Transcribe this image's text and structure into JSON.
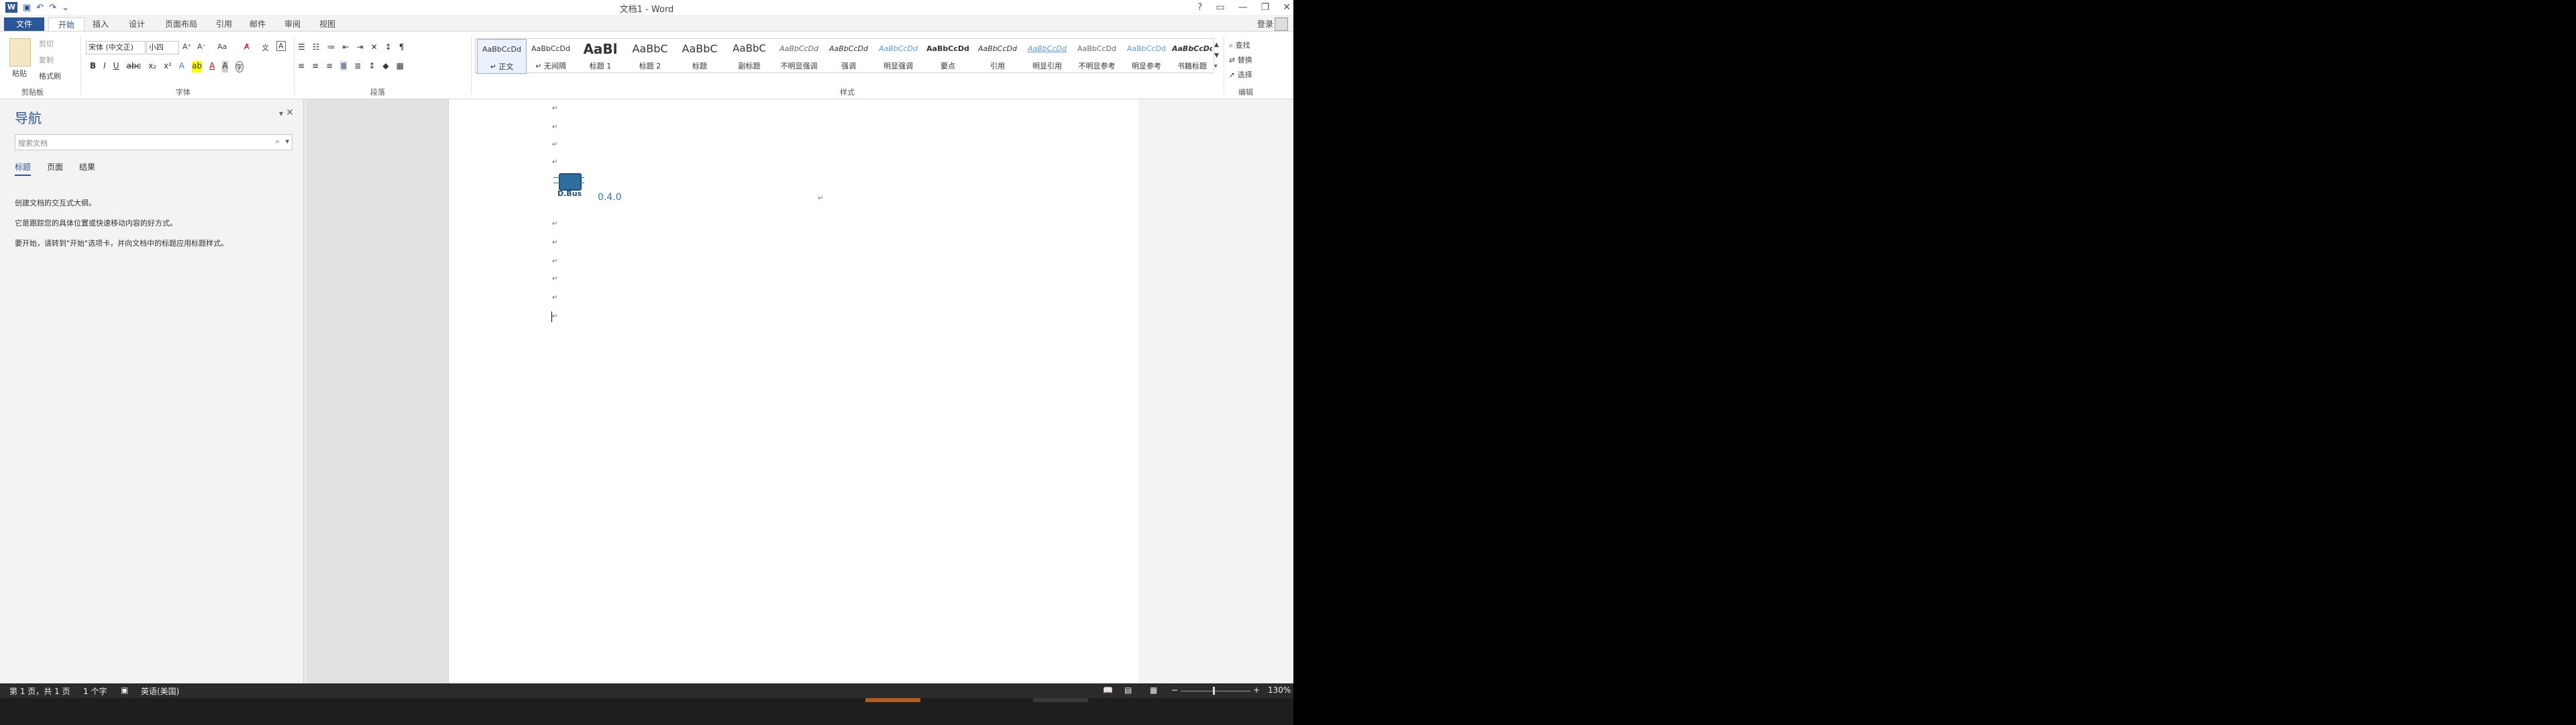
{
  "window": {
    "title": "文档1 - Word",
    "controls": [
      "?",
      "▭",
      "—",
      "❐",
      "✕"
    ]
  },
  "qat": {
    "logo": "W",
    "icons": [
      "save-icon",
      "undo-icon",
      "redo-icon",
      "customize-icon"
    ],
    "undo": "↶",
    "redo": "↷",
    "save": "▣",
    "more": "⌄"
  },
  "tabs": [
    "文件",
    "开始",
    "插入",
    "设计",
    "页面布局",
    "引用",
    "邮件",
    "审阅",
    "视图"
  ],
  "login": "登录",
  "clipboard": {
    "paste": "粘贴",
    "cut": "剪切",
    "copy": "复制",
    "painter": "格式刷",
    "label": "剪贴板"
  },
  "font": {
    "name": "宋体 (中文正)",
    "size": "小四",
    "label": "字体",
    "grow": "A⁺",
    "shrink": "A⁻",
    "case": "Aa",
    "clear": "A̸",
    "phonetic": "文",
    "border": "A",
    "bold": "B",
    "italic": "I",
    "underline": "U",
    "strike": "abc",
    "sub": "x₂",
    "sup": "x²",
    "effects": "A",
    "highlight": "ab",
    "color": "A",
    "shade": "A",
    "circle": "字"
  },
  "paragraph": {
    "label": "段落",
    "glyphs": [
      "☰",
      "☷",
      "≔",
      "⇤",
      "⇥",
      "✕",
      "↕",
      "¶",
      "≡",
      "≡",
      "≡",
      "≣",
      "≣",
      "↕",
      "◆",
      "▦"
    ]
  },
  "styles": {
    "label": "样式",
    "items": [
      {
        "preview": "AaBbCcDd",
        "name": "↵ 正文",
        "selected": true
      },
      {
        "preview": "AaBbCcDd",
        "name": "↵ 无间隔"
      },
      {
        "preview": "AaBl",
        "name": "标题 1"
      },
      {
        "preview": "AaBbC",
        "name": "标题 2"
      },
      {
        "preview": "AaBbC",
        "name": "标题"
      },
      {
        "preview": "AaBbC",
        "name": "副标题"
      },
      {
        "preview": "AaBbCcDd",
        "name": "不明显强调"
      },
      {
        "preview": "AaBbCcDd",
        "name": "强调"
      },
      {
        "preview": "AaBbCcDd",
        "name": "明显强调"
      },
      {
        "preview": "AaBbCcDd",
        "name": "要点"
      },
      {
        "preview": "AaBbCcDd",
        "name": "引用"
      },
      {
        "preview": "AaBbCcDd",
        "name": "明显引用"
      },
      {
        "preview": "AaBbCcDd",
        "name": "不明显参考"
      },
      {
        "preview": "AaBbCcDd",
        "name": "明显参考"
      },
      {
        "preview": "AaBbCcDd",
        "name": "书籍标题"
      }
    ]
  },
  "editing": {
    "find": "查找",
    "replace": "替换",
    "select": "选择",
    "label": "编辑"
  },
  "nav": {
    "title": "导航",
    "search_placeholder": "搜索文档",
    "tabs": [
      "标题",
      "页面",
      "结果"
    ],
    "lines": [
      "创建文档的交互式大纲。",
      "它是跟踪您的具体位置或快速移动内容的好方式。",
      "要开始，请转到\"开始\"选项卡，并向文档中的标题应用标题样式。"
    ]
  },
  "document": {
    "logo_text": "D.Bus",
    "version": "0.4.0",
    "para_mark": "↵"
  },
  "status": {
    "page": "第 1 页，共 1 页",
    "words": "1 个字",
    "lang": "英语(美国)",
    "zoom": "130%"
  }
}
